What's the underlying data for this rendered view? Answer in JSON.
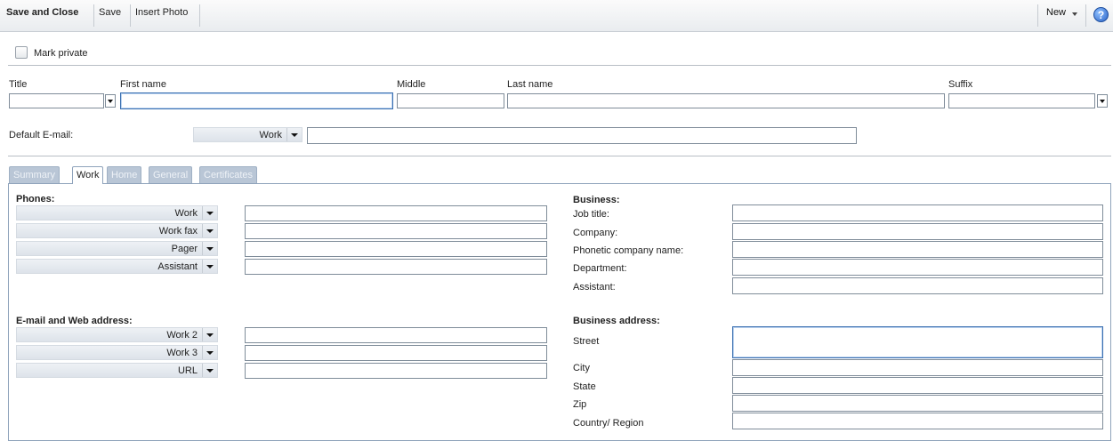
{
  "toolbar": {
    "save_and_close": "Save and Close",
    "save": "Save",
    "insert_photo": "Insert Photo",
    "new": "New",
    "help": "?"
  },
  "mark_private": "Mark private",
  "name_labels": {
    "title": "Title",
    "first_name": "First name",
    "middle": "Middle",
    "last_name": "Last name",
    "suffix": "Suffix"
  },
  "default_email": {
    "label": "Default E-mail:",
    "type": "Work"
  },
  "tabs": [
    "Summary",
    "Work",
    "Home",
    "General",
    "Certificates"
  ],
  "phones": {
    "heading": "Phones:",
    "items": [
      "Work",
      "Work fax",
      "Pager",
      "Assistant"
    ]
  },
  "email_web": {
    "heading": "E-mail and Web address:",
    "items": [
      "Work 2",
      "Work 3",
      "URL"
    ]
  },
  "business": {
    "heading": "Business:",
    "fields": [
      "Job title:",
      "Company:",
      "Phonetic company name:",
      "Department:",
      "Assistant:"
    ]
  },
  "business_address": {
    "heading": "Business address:",
    "fields": [
      "Street",
      "City",
      "State",
      "Zip",
      "Country/ Region"
    ]
  }
}
